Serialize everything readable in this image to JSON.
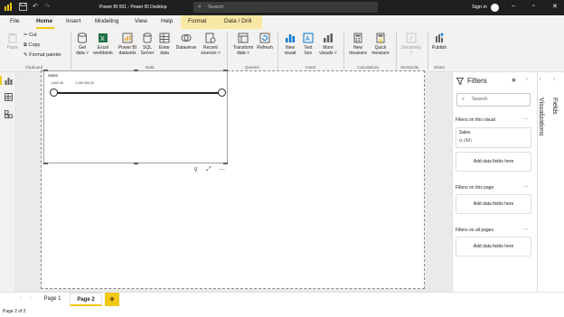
{
  "titlebar": {
    "title": "Power BI 001 - Power BI Desktop",
    "search_placeholder": "Search",
    "signin": "Sign in"
  },
  "menu": {
    "file": "File",
    "home": "Home",
    "insert": "Insert",
    "modeling": "Modeling",
    "view": "View",
    "help": "Help",
    "format": "Format",
    "data_drill": "Data / Drill"
  },
  "ribbon": {
    "paste": "Paste",
    "cut": "Cut",
    "copy": "Copy",
    "format_painter": "Format painter",
    "clipboard": "Clipboard",
    "get_data_1": "Get",
    "get_data_2": "data ˅",
    "excel_1": "Excel",
    "excel_2": "workbook",
    "pbi_1": "Power BI",
    "pbi_2": "datasets",
    "sql_1": "SQL",
    "sql_2": "Server",
    "enter_1": "Enter",
    "enter_2": "data",
    "dataverse": "Dataverse",
    "recent_1": "Recent",
    "recent_2": "sources ˅",
    "data_group": "Data",
    "transform_1": "Transform",
    "transform_2": "data ˅",
    "refresh": "Refresh",
    "queries": "Queries",
    "newvisual_1": "New",
    "newvisual_2": "visual",
    "textbox_1": "Text",
    "textbox_2": "box",
    "more_1": "More",
    "more_2": "visuals ˅",
    "insert_group": "Insert",
    "newmeasure_1": "New",
    "newmeasure_2": "measure",
    "quick_1": "Quick",
    "quick_2": "measure",
    "calculations": "Calculations",
    "sensitivity_1": "Sensitivity",
    "sensitivity_2": "˅",
    "sensitivity_group": "Sensitivity",
    "publish": "Publish",
    "share": "Share"
  },
  "slicer": {
    "title": "Sales",
    "min": "1,653.06",
    "max": "1,159,300.00"
  },
  "filters": {
    "title": "Filters",
    "search_placeholder": "Search",
    "on_visual": "Filters on this visual",
    "card_field": "Sales",
    "card_value": "is (All)",
    "add_fields": "Add data fields here",
    "on_page": "Filters on this page",
    "on_all": "Filters on all pages",
    "more": "..."
  },
  "panes": {
    "visualizations": "Visualizations",
    "fields": "Fields"
  },
  "pages": {
    "page1": "Page 1",
    "page2": "Page 2",
    "add": "+"
  },
  "status": "Page 2 of 2",
  "colors": {
    "accent": "#f2c811",
    "titlebar": "#1f1f1f",
    "ribbon": "#f3f2f1"
  }
}
